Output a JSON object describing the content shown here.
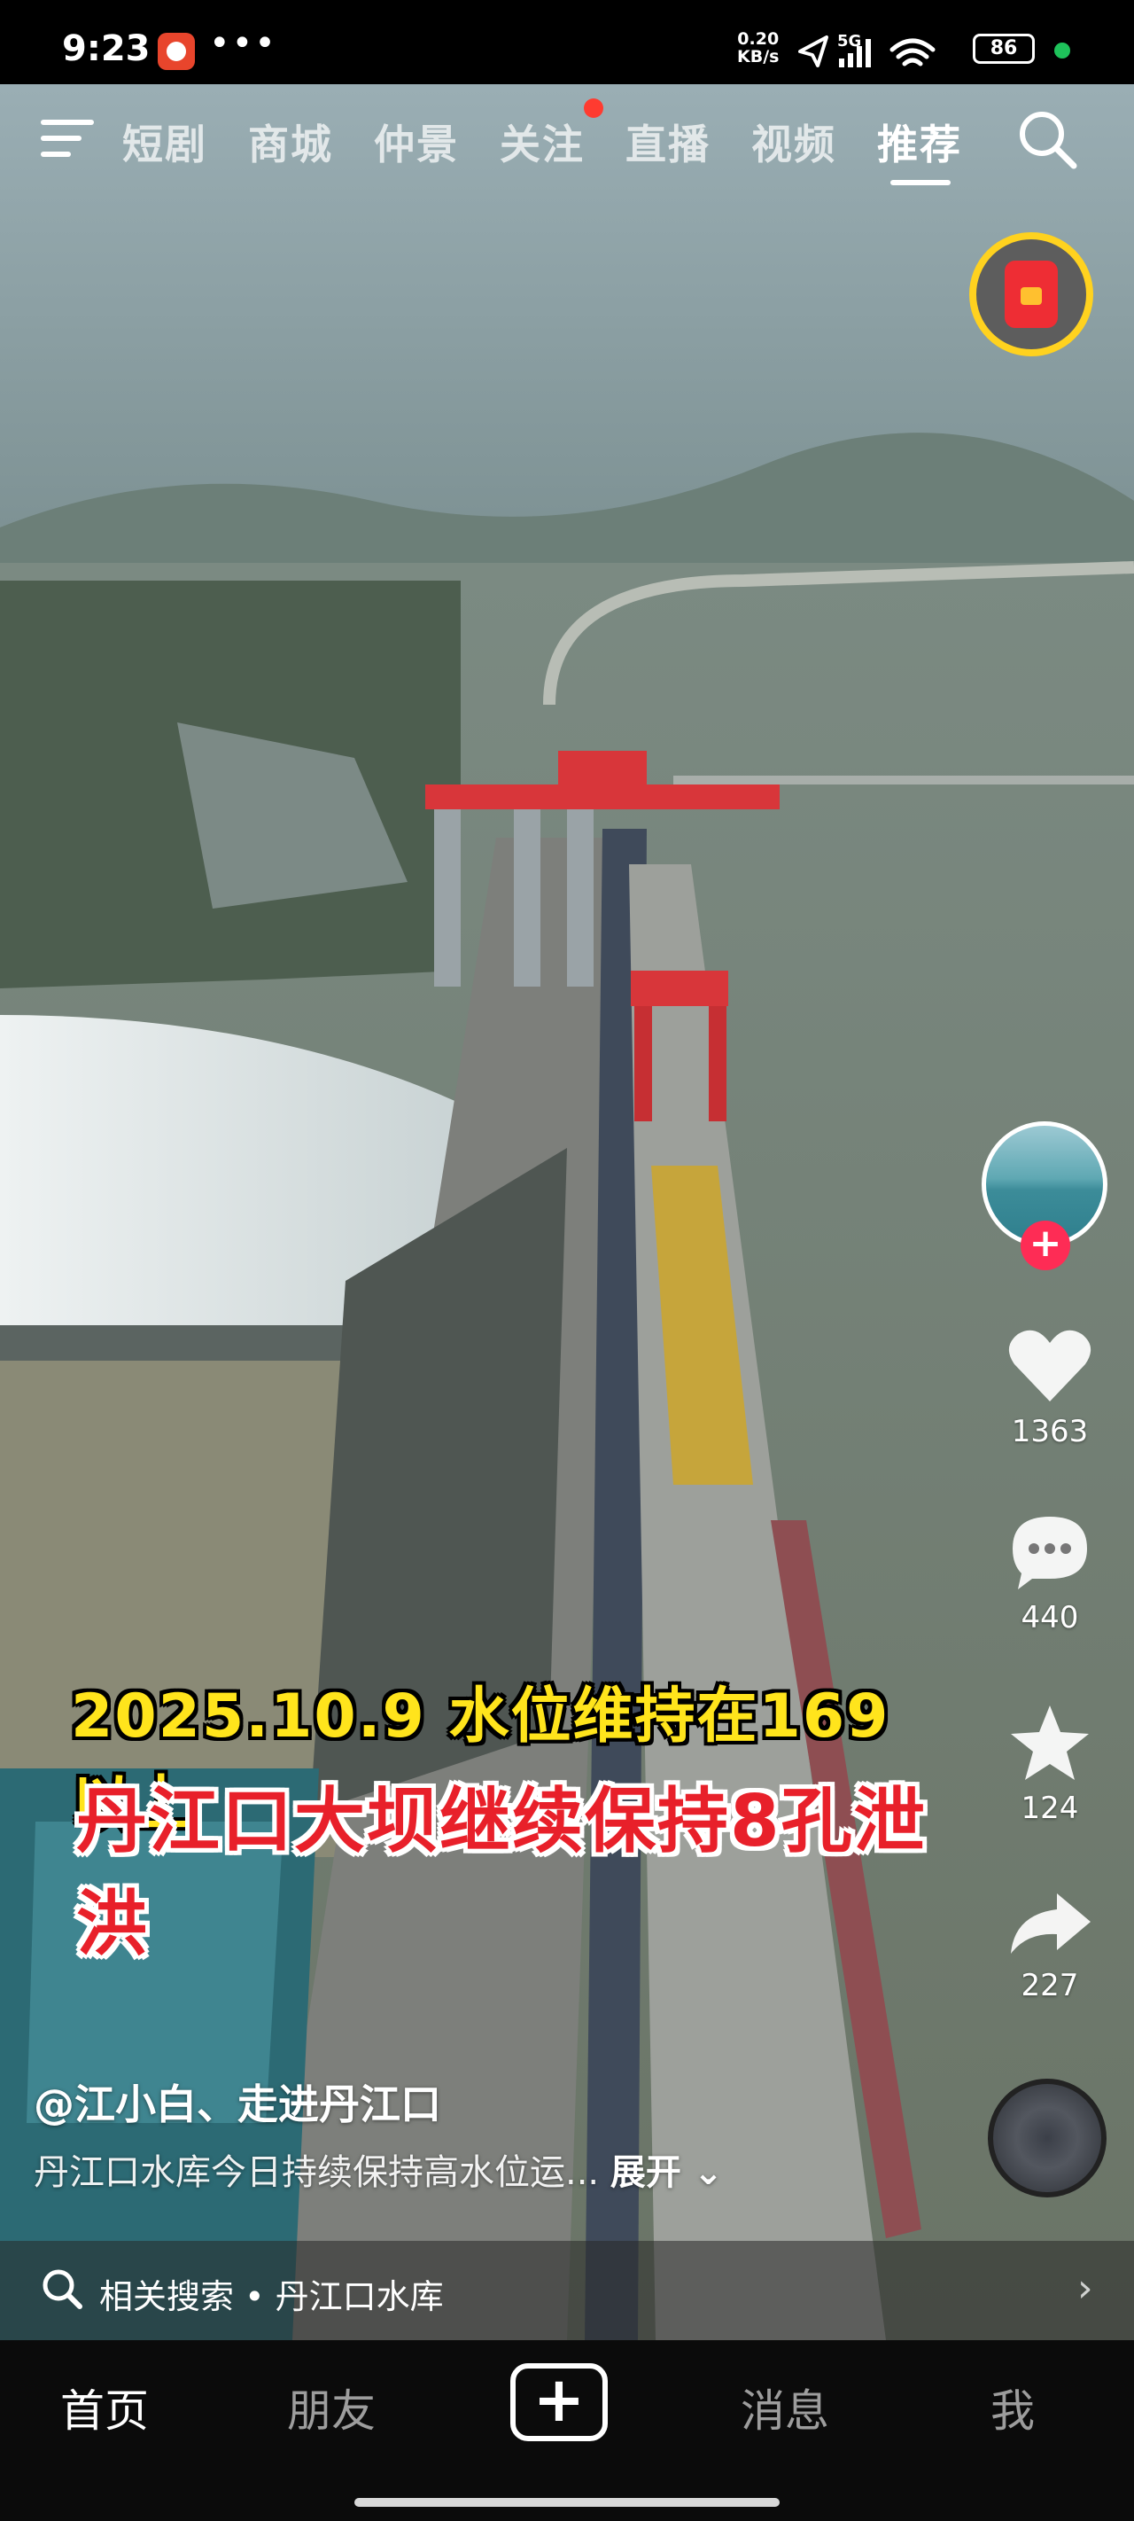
{
  "status_bar": {
    "time": "9:23",
    "more": "•••",
    "net_speed_value": "0.20",
    "net_speed_unit": "KB/s",
    "signal": "5G",
    "battery": "86"
  },
  "top_nav": {
    "tabs": [
      {
        "label": "短剧"
      },
      {
        "label": "商城"
      },
      {
        "label": "仲景"
      },
      {
        "label": "关注"
      },
      {
        "label": "直播"
      },
      {
        "label": "视频"
      },
      {
        "label": "推荐"
      }
    ],
    "active_tab": "推荐"
  },
  "video": {
    "caption_line1": "2025.10.9  水位维持在169以上",
    "caption_line2": "丹江口大坝继续保持8孔泄洪",
    "author": "@江小白、走进丹江口",
    "description": "丹江口水库今日持续保持高水位运...",
    "expand_label": "展开 ⌄"
  },
  "actions": {
    "likes": "1363",
    "comments": "440",
    "favorites": "124",
    "shares": "227"
  },
  "related_search": {
    "text": "相关搜索 • 丹江口水库",
    "arrow": "›"
  },
  "bottom_nav": {
    "home": "首页",
    "friends": "朋友",
    "create": "+",
    "messages": "消息",
    "me": "我"
  },
  "colors": {
    "accent_red": "#fe2c55",
    "caption_yellow": "#ffe41c",
    "caption_red": "#e8202a",
    "battery_dot": "#1ec25a"
  }
}
